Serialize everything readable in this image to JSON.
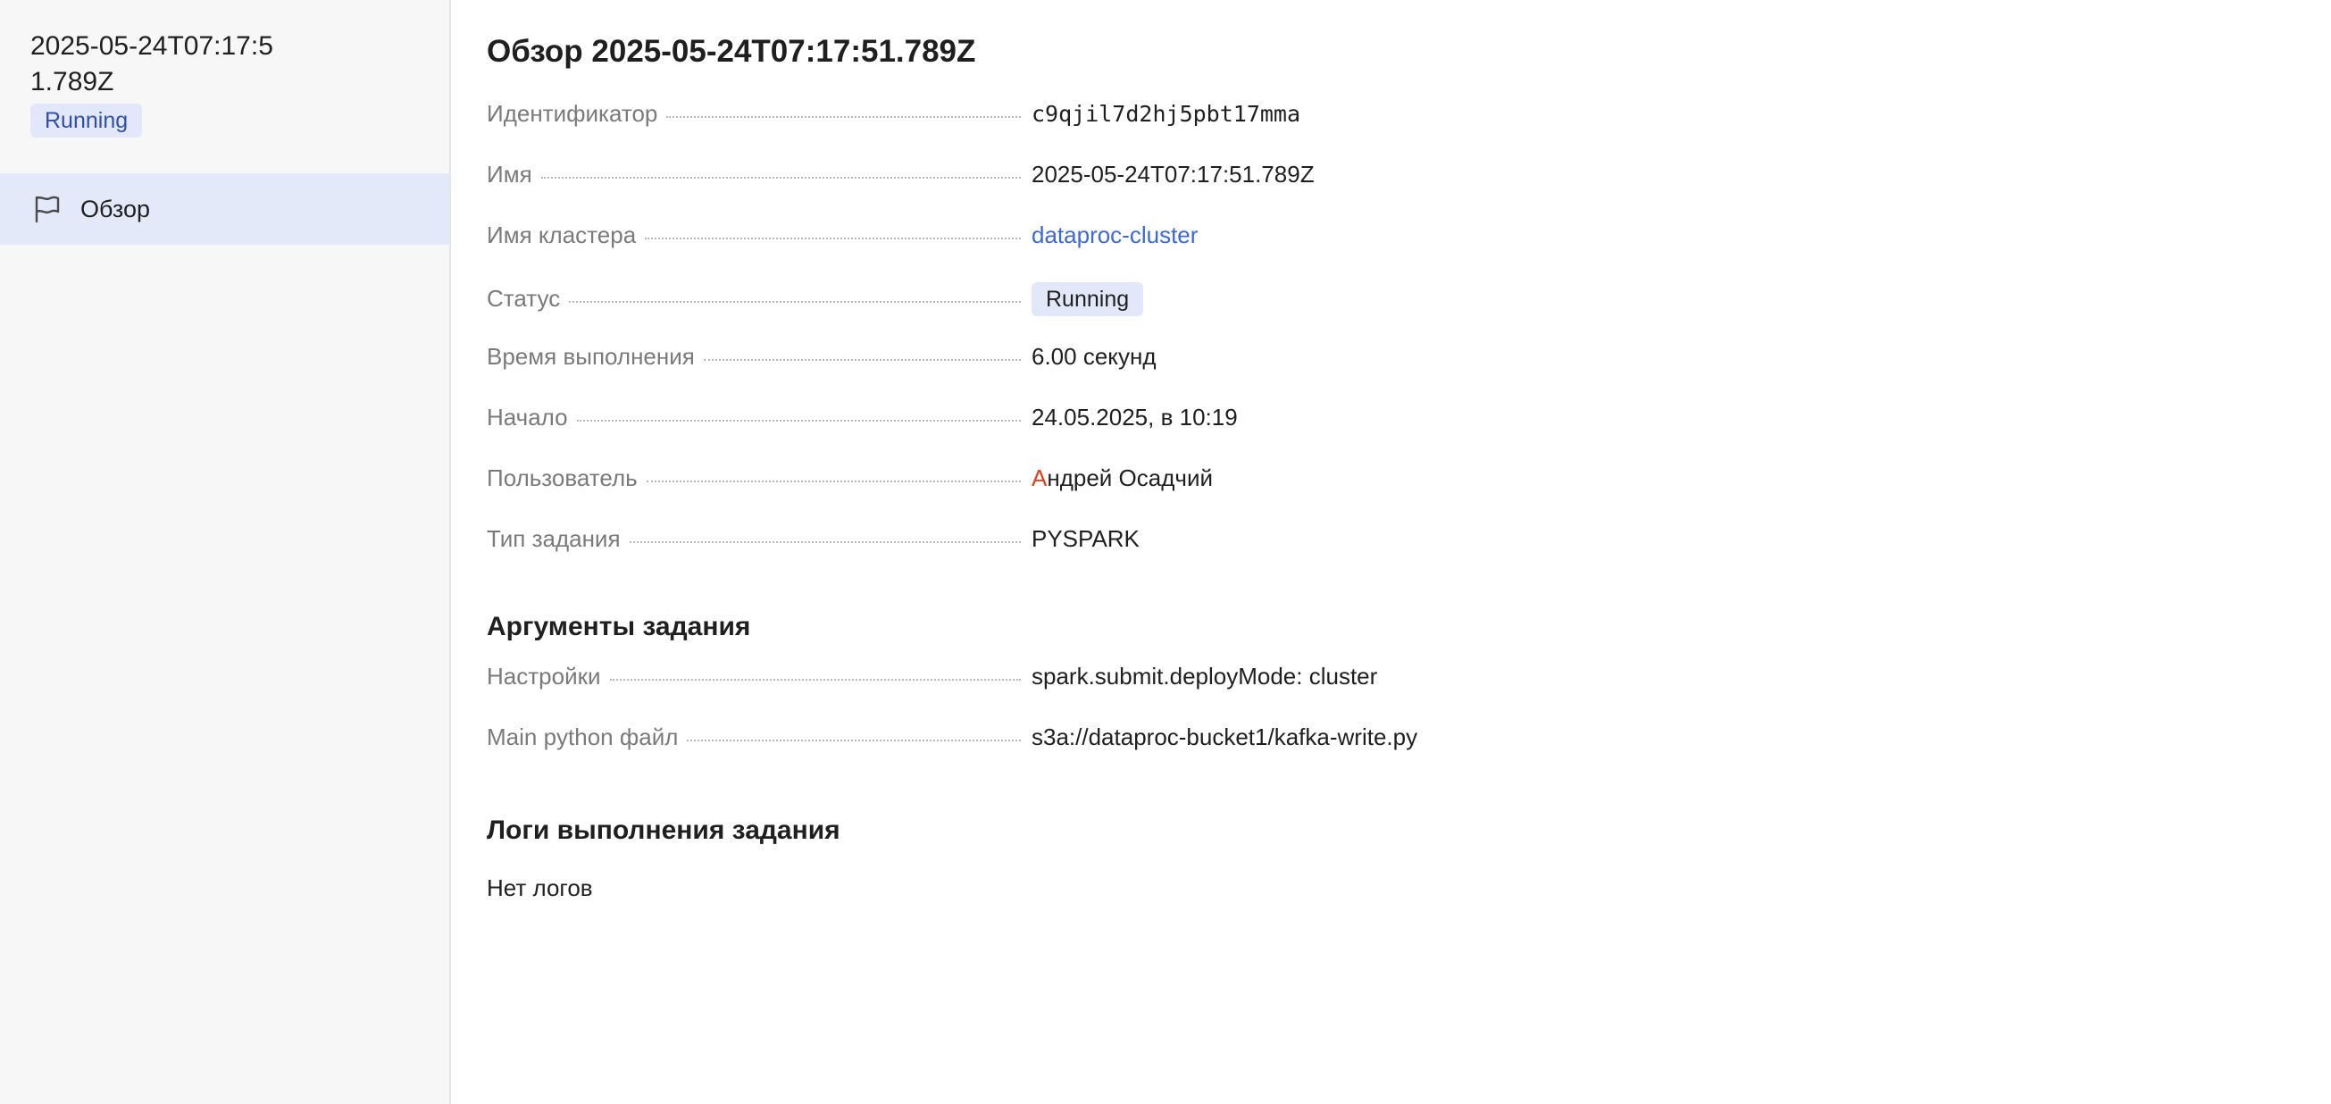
{
  "sidebar": {
    "title": "2025-05-24T07:17:51.789Z",
    "status": "Running",
    "nav": [
      {
        "label": "Обзор",
        "icon": "flag-icon"
      }
    ]
  },
  "main": {
    "title": "Обзор 2025-05-24T07:17:51.789Z",
    "properties": {
      "id": {
        "name": "Идентификатор",
        "value": "c9qjil7d2hj5pbt17mma"
      },
      "name": {
        "name": "Имя",
        "value": "2025-05-24T07:17:51.789Z"
      },
      "cluster": {
        "name": "Имя кластера",
        "value": "dataproc-cluster"
      },
      "status": {
        "name": "Статус",
        "value": "Running"
      },
      "duration": {
        "name": "Время выполнения",
        "value": "6.00 секунд"
      },
      "start": {
        "name": "Начало",
        "value": "24.05.2025, в 10:19"
      },
      "user": {
        "name": "Пользователь",
        "initial": "А",
        "rest": "ндрей Осадчий"
      },
      "job_type": {
        "name": "Тип задания",
        "value": "PYSPARK"
      }
    },
    "args_section": {
      "title": "Аргументы задания",
      "settings": {
        "name": "Настройки",
        "value": "spark.submit.deployMode: cluster"
      },
      "main_python": {
        "name": "Main python файл",
        "value": "s3a://dataproc-bucket1/kafka-write.py"
      }
    },
    "logs_section": {
      "title": "Логи выполнения задания",
      "empty": "Нет логов"
    }
  },
  "colors": {
    "accent_link": "#3e68d6",
    "badge_bg": "#e2e8fa",
    "badge_text": "#2f4fa8",
    "selected_nav_bg": "#e3e9f9",
    "user_initial": "#e4401c"
  }
}
